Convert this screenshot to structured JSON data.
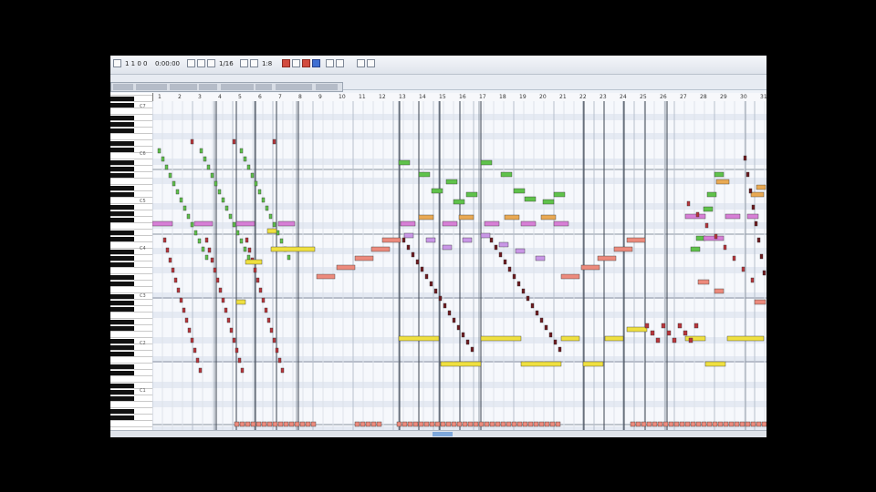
{
  "app": {
    "toolbar": {
      "position_text": "1 1 0 0",
      "time_text": "0:00:00",
      "quantize_text": "1/16",
      "zoom_text": "1:8"
    },
    "ruler_labels": [
      "1",
      "2",
      "3",
      "4",
      "5",
      "6",
      "7",
      "8",
      "9",
      "10",
      "11",
      "12",
      "13",
      "14",
      "15",
      "16",
      "17",
      "18",
      "19",
      "20",
      "21",
      "22",
      "23",
      "24",
      "25",
      "26",
      "27",
      "28",
      "29",
      "30",
      "31"
    ],
    "keyboard_labels": [
      "C7",
      "C6",
      "C5",
      "C4",
      "C3",
      "C2",
      "C1"
    ],
    "colors": {
      "green": "#5fc24b",
      "pink": "#d77fd6",
      "orange": "#e9a953",
      "yellow": "#efe040",
      "salmon": "#ec8a7c",
      "red": "#b8353b",
      "dark_red": "#6d1a1f",
      "lavender": "#c997e6"
    }
  }
}
